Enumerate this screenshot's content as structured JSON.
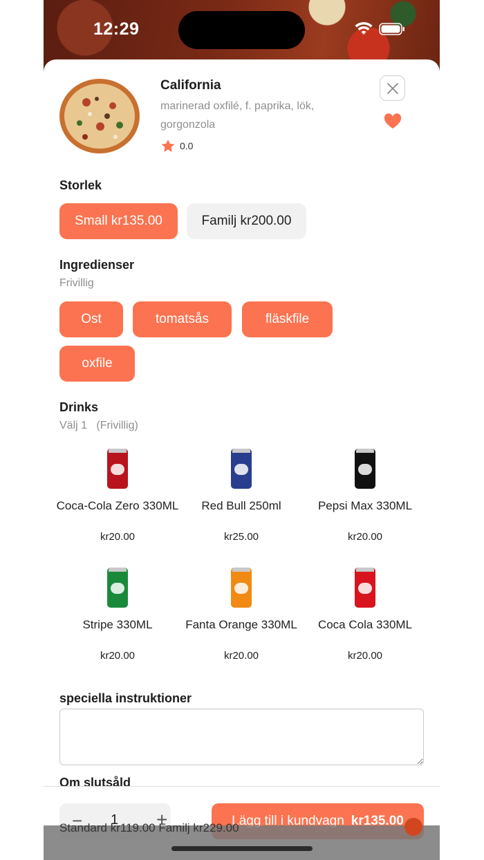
{
  "status_bar": {
    "time": "12:29"
  },
  "product": {
    "name": "California",
    "description": "marinerad oxfilé, f. paprika, lök, gorgonzola",
    "rating": "0.0"
  },
  "size": {
    "title": "Storlek",
    "options": [
      {
        "label": "Small kr135.00",
        "selected": true
      },
      {
        "label": "Familj kr200.00",
        "selected": false
      }
    ]
  },
  "ingredients": {
    "title": "Ingredienser",
    "subtitle": "Frivillig",
    "options": [
      "Ost",
      "tomatsås",
      "fläskfile",
      "oxfile"
    ]
  },
  "drinks": {
    "title": "Drinks",
    "subtitle": "Välj 1   (Frivillig)",
    "items": [
      {
        "name": "Coca-Cola Zero 330ML",
        "price": "kr20.00",
        "color": "#b8141d"
      },
      {
        "name": "Red Bull 250ml",
        "price": "kr25.00",
        "color": "#2a3e8f"
      },
      {
        "name": "Pepsi Max 330ML",
        "price": "kr20.00",
        "color": "#111111"
      },
      {
        "name": "Stripe 330ML",
        "price": "kr20.00",
        "color": "#1a8a3a"
      },
      {
        "name": "Fanta Orange 330ML",
        "price": "kr20.00",
        "color": "#f08a13"
      },
      {
        "name": "Coca Cola 330ML",
        "price": "kr20.00",
        "color": "#d8141f"
      }
    ]
  },
  "instructions": {
    "title": "speciella instruktioner",
    "value": ""
  },
  "out_of_stock": {
    "title": "Om slutsåld"
  },
  "cart": {
    "quantity": "1",
    "minus": "−",
    "plus": "+",
    "add_label": "Lägg till i kundvagn",
    "price": "kr135.00"
  },
  "overlay": {
    "text": "Standard kr119.00   Familj kr229.00"
  },
  "colors": {
    "accent": "#fb7350",
    "chip_inactive": "#f1f1f1"
  }
}
